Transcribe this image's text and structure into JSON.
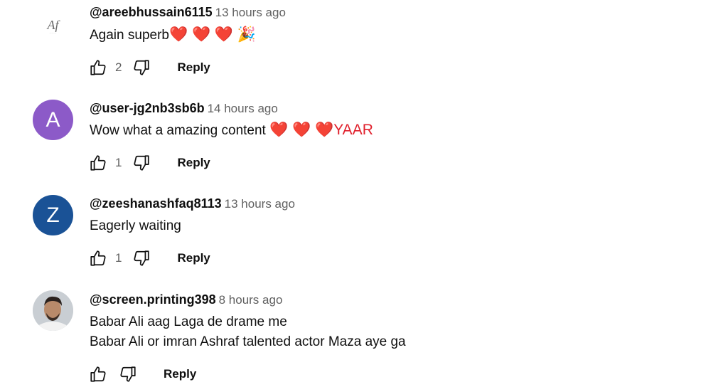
{
  "comments": [
    {
      "handle": "@areebhussain6115",
      "time": "13 hours ago",
      "text": "Again superb",
      "emoji_suffix": "❤️ ❤️ ❤️ 🎉",
      "likes": "2",
      "reply_label": "Reply",
      "avatar": {
        "type": "logo",
        "glyph": "Af"
      }
    },
    {
      "handle": "@user-jg2nb3sb6b",
      "time": "14 hours ago",
      "text": "Wow what a amazing content",
      "emoji_suffix": "❤️ ❤️ ❤️YAAR",
      "likes": "1",
      "reply_label": "Reply",
      "avatar": {
        "type": "letter",
        "letter": "A",
        "color": "#8c5ac8"
      }
    },
    {
      "handle": "@zeeshanashfaq8113",
      "time": "13 hours ago",
      "text": "Eagerly waiting",
      "likes": "1",
      "reply_label": "Reply",
      "avatar": {
        "type": "letter",
        "letter": "Z",
        "color": "#1a5296"
      }
    },
    {
      "handle": "@screen.printing398",
      "time": "8 hours ago",
      "lines": [
        "Babar Ali aag Laga de drame me",
        "Babar Ali or imran Ashraf talented actor Maza aye ga"
      ],
      "likes": "",
      "reply_label": "Reply",
      "avatar": {
        "type": "photo"
      }
    }
  ],
  "icons": {
    "like": "thumbs-up-icon",
    "dislike": "thumbs-down-icon"
  },
  "colors": {
    "text": "#0f0f0f",
    "secondary": "#606060",
    "heart": "#e0202c"
  }
}
